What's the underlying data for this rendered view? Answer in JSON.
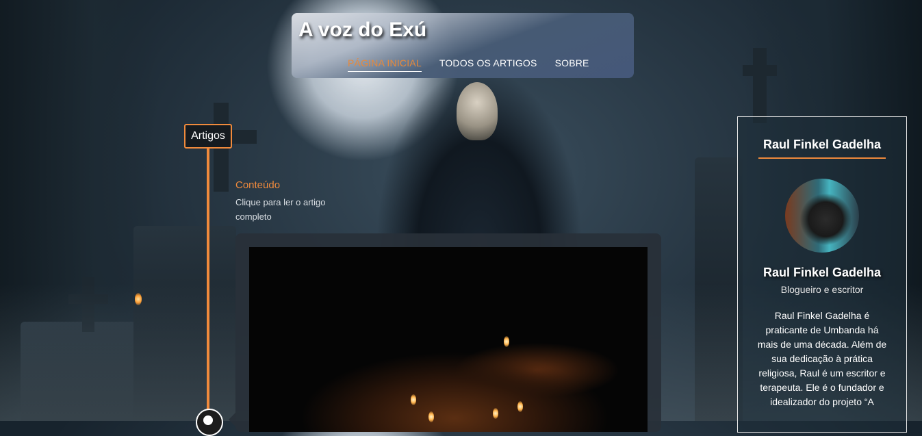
{
  "header": {
    "site_title": "A voz do Exú",
    "nav": [
      {
        "label": "PÁGINA INICIAL",
        "active": true
      },
      {
        "label": "TODOS OS ARTIGOS",
        "active": false
      },
      {
        "label": "SOBRE",
        "active": false
      }
    ]
  },
  "timeline": {
    "label": "Artigos",
    "post": {
      "heading": "Conteúdo",
      "description": "Clique para ler o artigo completo"
    }
  },
  "author": {
    "box_title": "Raul Finkel Gadelha",
    "name": "Raul Finkel Gadelha",
    "role": "Blogueiro e escritor",
    "bio": "Raul Finkel Gadelha é praticante de Umbanda há mais de uma década. Além de sua dedicação à prática religiosa, Raul é um escritor e terapeuta. Ele é o fundador e idealizador do projeto “A"
  },
  "colors": {
    "accent": "#f08a3c",
    "header_bg": "#45587a",
    "card_bg": "#283038"
  }
}
